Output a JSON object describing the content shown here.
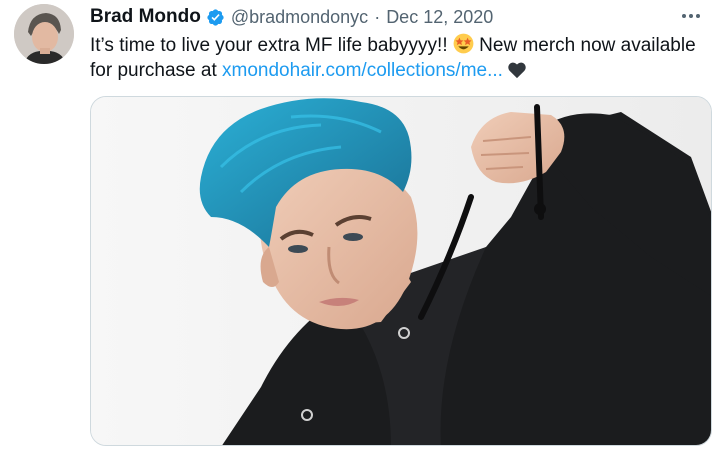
{
  "tweet": {
    "author_name": "Brad Mondo",
    "handle": "@bradmondonyc",
    "separator": "·",
    "date": "Dec 12, 2020",
    "text_part1": "It’s time to live your extra MF life babyyyy!! ",
    "text_part2": " New merch now available for purchase at ",
    "link_text": "xmondohair.com/collections/me...",
    "accent_color": "#1d9bf0",
    "icons": {
      "verified": "verified-badge-icon",
      "emoji": "star-struck-emoji-icon",
      "heart": "black-heart-icon",
      "more": "more-options-icon"
    },
    "media": {
      "description_icon": "photo",
      "hair_color": "#1f8fb8"
    }
  }
}
